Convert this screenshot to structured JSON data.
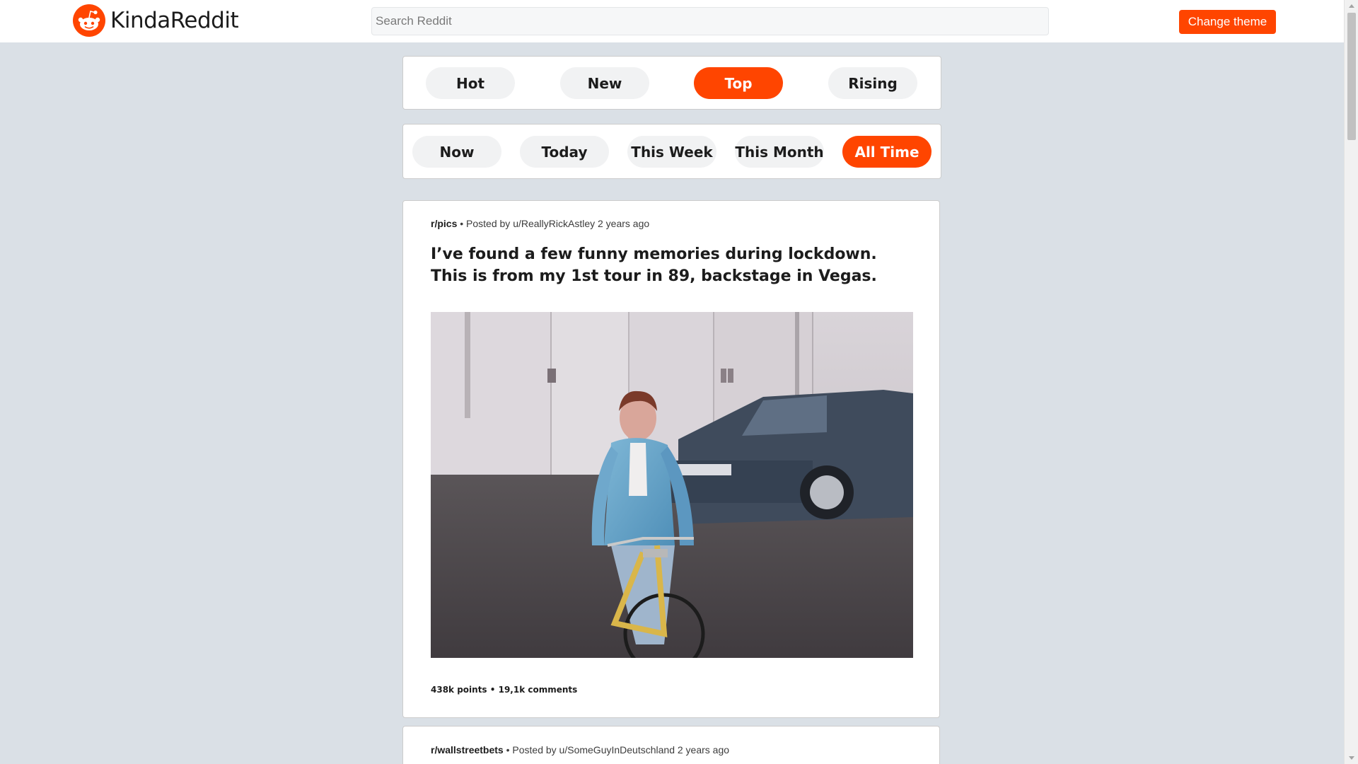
{
  "header": {
    "logo_text": "KindaReddit",
    "logo_icon": "reddit-alien-icon",
    "search_placeholder": "Search Reddit",
    "theme_button": "Change theme"
  },
  "sort_tabs": [
    {
      "label": "Hot",
      "active": false
    },
    {
      "label": "New",
      "active": false
    },
    {
      "label": "Top",
      "active": true
    },
    {
      "label": "Rising",
      "active": false
    }
  ],
  "time_tabs": [
    {
      "label": "Now",
      "active": false
    },
    {
      "label": "Today",
      "active": false
    },
    {
      "label": "This Week",
      "active": false
    },
    {
      "label": "This Month",
      "active": false
    },
    {
      "label": "All Time",
      "active": true
    }
  ],
  "posts": [
    {
      "subreddit": "r/pics",
      "meta": " • Posted by u/ReallyRickAstley 2 years ago",
      "title": "I’ve found a few funny memories during lockdown. This is from my 1st tour in 89, backstage in Vegas.",
      "stats": "438k points • 19,1k comments"
    },
    {
      "subreddit": "r/wallstreetbets",
      "meta": " • Posted by u/SomeGuyInDeutschland 2 years ago"
    }
  ],
  "colors": {
    "accent": "#ff4500",
    "background": "#dae0e6",
    "card": "#ffffff",
    "pill": "#f1f2f3"
  }
}
